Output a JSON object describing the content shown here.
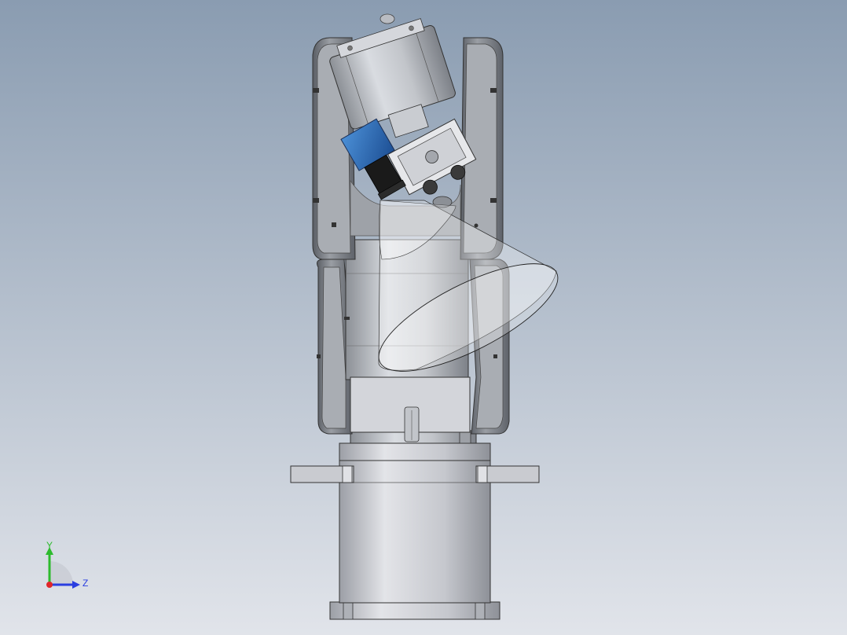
{
  "viewport": {
    "background_top": "#8a9cb1",
    "background_bottom": "#dfe2e8"
  },
  "colors": {
    "robot_metal": "#a7abb1",
    "robot_dark": "#6f747b",
    "camera_blue": "#2f6fbf",
    "lens_black": "#1a1a1a",
    "cone_fill": "#ffffff",
    "base_metal": "#b9bbc2",
    "axis_x": "#e0262a",
    "axis_y": "#2dbb2d",
    "axis_z": "#2a3ee0"
  },
  "triad": {
    "y_label": "Y",
    "z_label": "Z",
    "icon": "coordinate-triad-icon"
  }
}
